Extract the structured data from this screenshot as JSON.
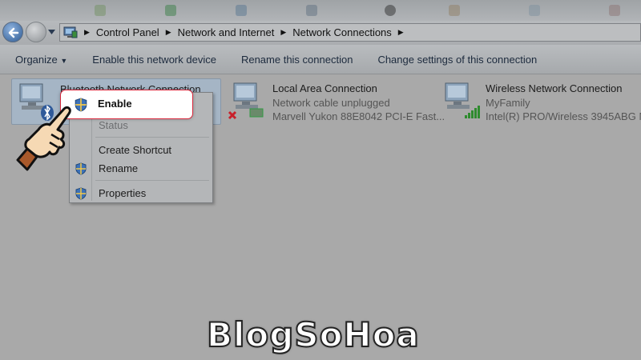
{
  "address": {
    "breadcrumbs": [
      "Control Panel",
      "Network and Internet",
      "Network Connections"
    ]
  },
  "toolbar": {
    "organize": "Organize",
    "enable_device": "Enable this network device",
    "rename_connection": "Rename this connection",
    "change_settings": "Change settings of this connection"
  },
  "connections": [
    {
      "title": "Bluetooth Network Connection",
      "status": "Di",
      "device": ""
    },
    {
      "title": "Local Area Connection",
      "status": "Network cable unplugged",
      "device": "Marvell Yukon 88E8042 PCI-E Fast..."
    },
    {
      "title": "Wireless Network Connection",
      "status": "MyFamily",
      "device": "Intel(R) PRO/Wireless 3945ABG N..."
    }
  ],
  "context_menu": {
    "enable": "Enable",
    "status": "Status",
    "create_shortcut": "Create Shortcut",
    "rename": "Rename",
    "properties": "Properties"
  },
  "watermark": "BlogSoHoa",
  "colors": {
    "highlight_border": "#d8263a",
    "selection": "#a5b5c5",
    "background": "#a9a9a9"
  }
}
